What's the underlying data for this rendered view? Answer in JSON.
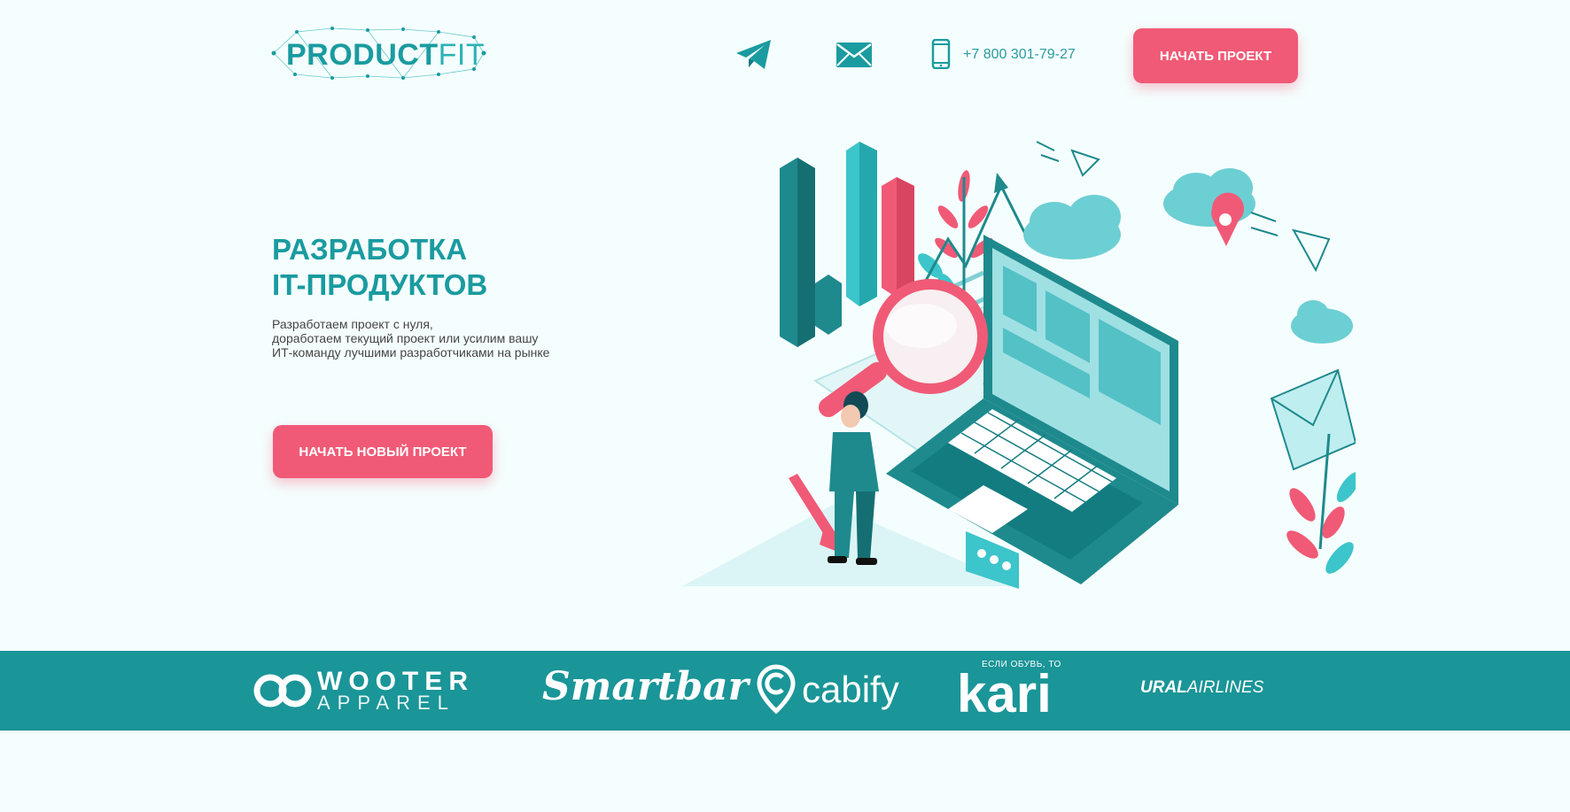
{
  "header": {
    "logo_text_bold": "PRODUCT",
    "logo_text_light": "FIT",
    "phone": "+7 800 301-79-27",
    "cta_label": "НАЧАТЬ ПРОЕКТ",
    "icons": [
      "telegram-icon",
      "mail-icon",
      "phone-icon"
    ]
  },
  "hero": {
    "title_line1": "РАЗРАБОТКА",
    "title_line2": "IT-ПРОДУКТОВ",
    "subtitle_line1": "Разработаем проект с нуля,",
    "subtitle_line2": "доработаем текущий проект или усилим вашу",
    "subtitle_line3": "ИТ-команду лучшими разработчиками на рынке",
    "cta_label": "НАЧАТЬ НОВЫЙ ПРОЕКТ"
  },
  "clients": {
    "wooter_line1": "WOOTER",
    "wooter_line2": "APPAREL",
    "smartbar": "Smartbar",
    "cabify": "cabify",
    "kari_tagline": "ЕСЛИ ОБУВЬ, ТО",
    "kari": "kari",
    "ural_bold": "URAL",
    "ural_light": "AIRLINES"
  },
  "colors": {
    "brand_teal": "#1a9ba0",
    "accent_pink": "#f05a76",
    "band_teal": "#1a9598",
    "background": "#f5fefe"
  }
}
